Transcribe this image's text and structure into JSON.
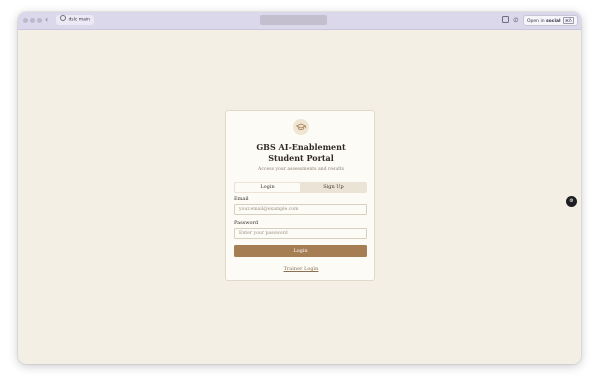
{
  "browser": {
    "tab_title": "dslc main",
    "back_glyph": "‹",
    "open_in_prefix": "Open in",
    "open_in_app": "social",
    "open_in_shortcut": "⌘O",
    "more_glyph": "›",
    "link_glyph": "⊘"
  },
  "portal": {
    "title_line1": "GBS AI-Enablement",
    "title_line2": "Student Portal",
    "subtitle": "Access your assessments and results",
    "tabs": {
      "login": "Login",
      "signup": "Sign Up"
    },
    "email_label": "Email",
    "email_placeholder": "your.email@example.com",
    "password_label": "Password",
    "password_placeholder": "Enter your password",
    "login_button": "Login",
    "trainer_link": "Trainer Login"
  },
  "floating_button": {
    "glyph": "⚙"
  },
  "colors": {
    "page_background": "#f4efe4",
    "card_background": "#fdfbf6",
    "accent": "#a57e54",
    "tab_track": "#ebe3d6"
  },
  "icons": {
    "logo": "graduation-cap-icon",
    "tab": "globe-icon",
    "floating": "settings-icon"
  }
}
